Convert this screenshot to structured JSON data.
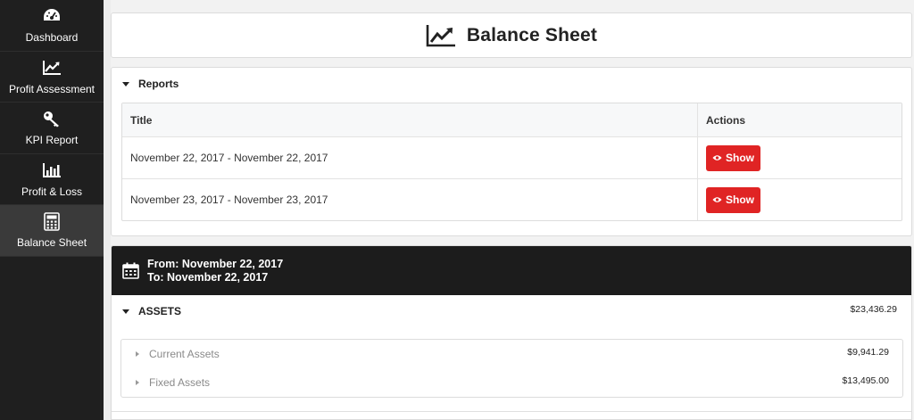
{
  "sidebar": {
    "items": [
      {
        "label": "Dashboard",
        "icon": "dashboard-icon"
      },
      {
        "label": "Profit Assessment",
        "icon": "line-chart-icon"
      },
      {
        "label": "KPI Report",
        "icon": "key-icon"
      },
      {
        "label": "Profit & Loss",
        "icon": "bar-chart-icon"
      },
      {
        "label": "Balance Sheet",
        "icon": "calculator-icon",
        "active": true
      }
    ]
  },
  "page": {
    "title": "Balance Sheet",
    "title_icon": "line-chart-icon"
  },
  "reports": {
    "heading": "Reports",
    "columns": [
      "Title",
      "Actions"
    ],
    "rows": [
      {
        "title": "November 22, 2017 - November 22, 2017",
        "action": "Show"
      },
      {
        "title": "November 23, 2017 - November 23, 2017",
        "action": "Show"
      }
    ]
  },
  "balance_sheet": {
    "from": "From: November 22, 2017",
    "to": "To: November 22, 2017",
    "assets": {
      "label": "ASSETS",
      "amount": "$23,436.29",
      "items": [
        {
          "label": "Current Assets",
          "amount": "$9,941.29"
        },
        {
          "label": "Fixed Assets",
          "amount": "$13,495.00"
        }
      ]
    }
  },
  "colors": {
    "sidebar_bg": "#1f1f1f",
    "sidebar_active": "#3a3a3a",
    "show_button": "#e02424",
    "header_bar": "#1c1c1c"
  }
}
